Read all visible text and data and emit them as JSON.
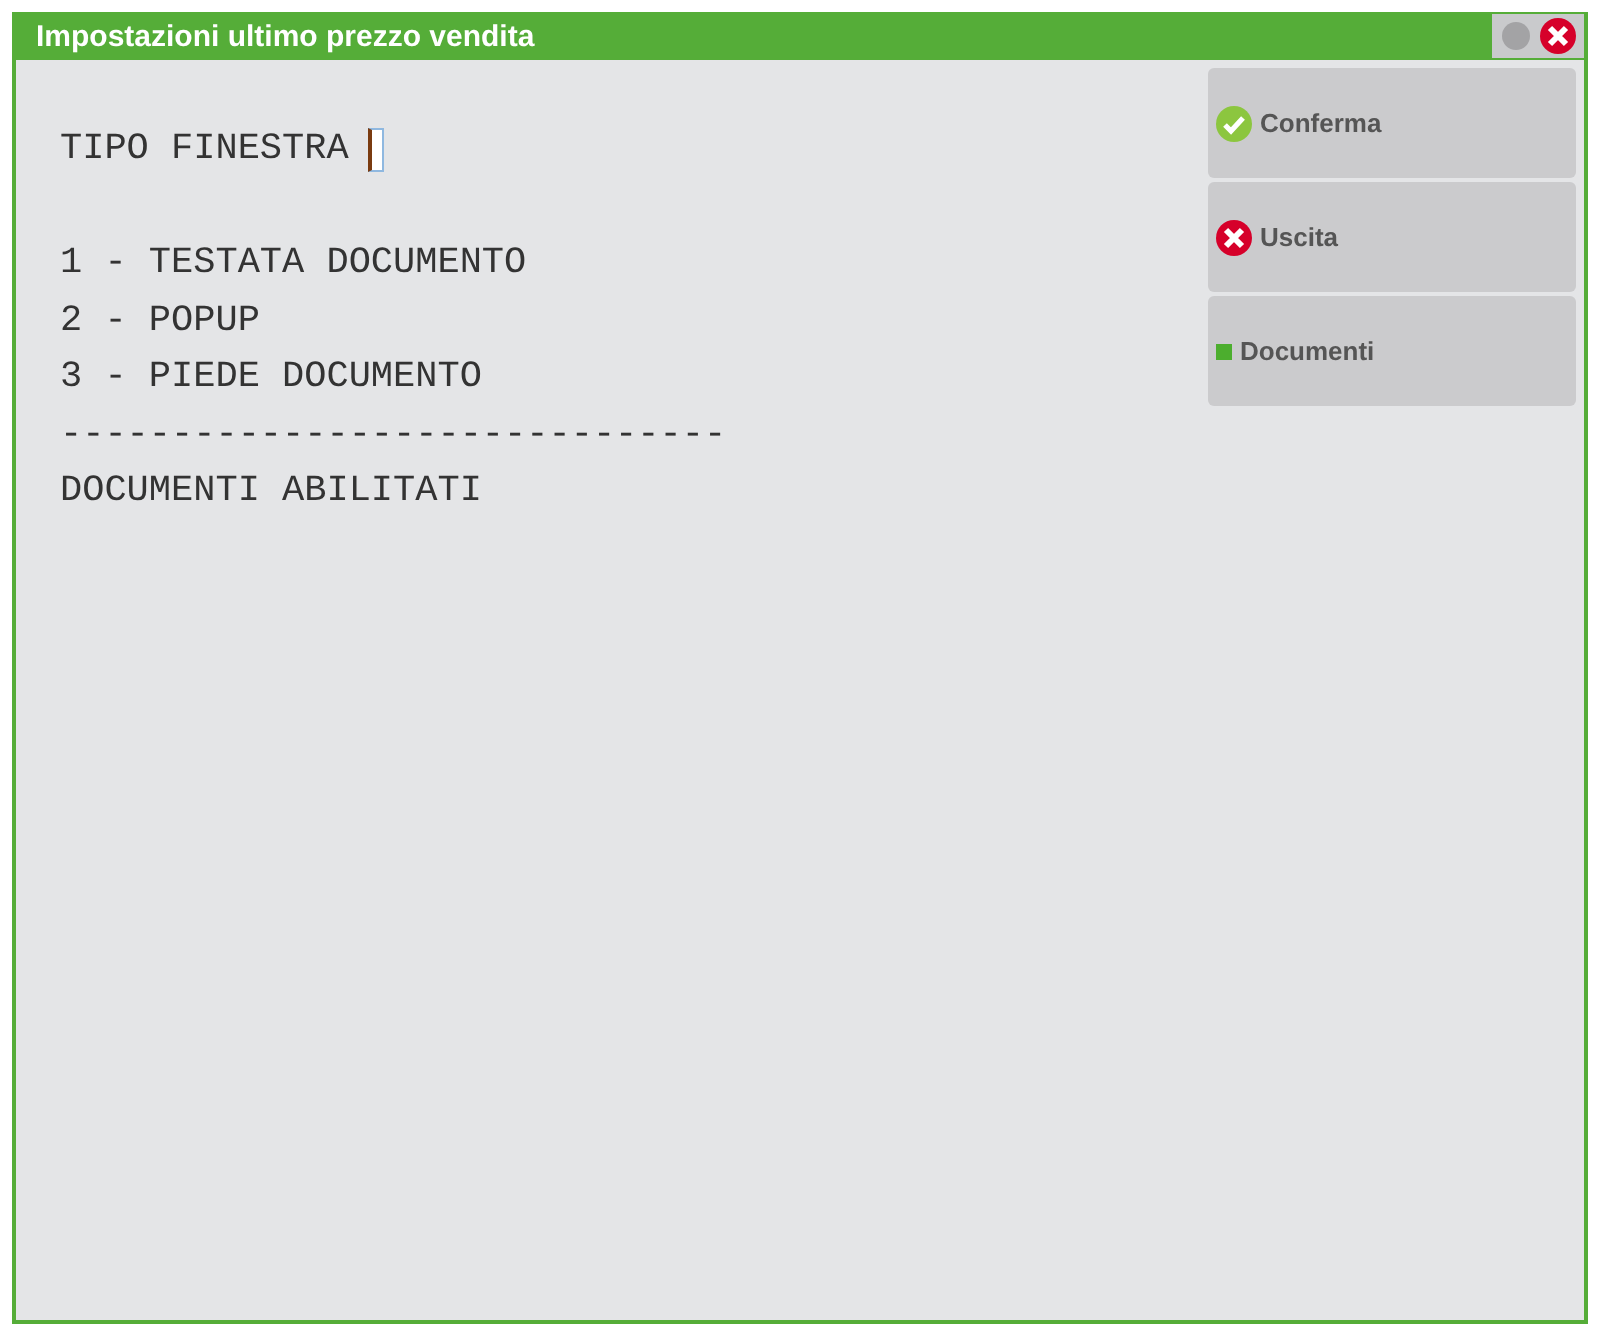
{
  "window": {
    "title": "Impostazioni ultimo prezzo vendita"
  },
  "prompt": {
    "label": "TIPO FINESTRA"
  },
  "lines": [
    "1 - TESTATA DOCUMENTO",
    "2 - POPUP",
    "3 - PIEDE DOCUMENTO",
    "------------------------------",
    "DOCUMENTI ABILITATI"
  ],
  "buttons": [
    {
      "label": "Conferma",
      "kind": "confirm"
    },
    {
      "label": "Uscita",
      "kind": "exit"
    },
    {
      "label": "Documenti",
      "kind": "documents"
    }
  ]
}
